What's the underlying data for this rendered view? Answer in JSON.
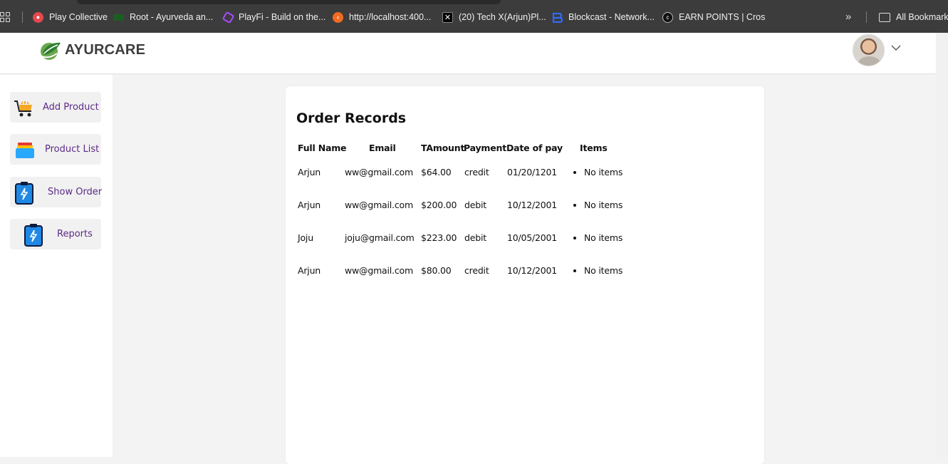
{
  "bookmarks": {
    "items": [
      {
        "label": "Play Collective",
        "icon": "play-collective-icon",
        "color": "#e5484d"
      },
      {
        "label": "Root - Ayurveda an...",
        "icon": "root-icon",
        "color": "#2e7d32"
      },
      {
        "label": "PlayFi - Build on the...",
        "icon": "playfi-icon",
        "color": "#a64dff"
      },
      {
        "label": "http://localhost:400...",
        "icon": "localhost-icon",
        "color": "#f26b22"
      },
      {
        "label": "(20) Tech X(Arjun)Pl...",
        "icon": "x-icon",
        "color": "#000000"
      },
      {
        "label": "Blockcast - Network...",
        "icon": "blockcast-icon",
        "color": "#2563eb"
      },
      {
        "label": "EARN POINTS | Cros",
        "icon": "earn-points-icon",
        "color": "#111111"
      }
    ],
    "more": "»",
    "all_bookmarks": "All Bookmarks"
  },
  "header": {
    "logo_text": "AYURCARE"
  },
  "sidebar": {
    "items": [
      {
        "label": "Add Product",
        "icon": "cart-icon"
      },
      {
        "label": "Product List",
        "icon": "stack-icon"
      },
      {
        "label": "Show Order",
        "icon": "clipboard-icon"
      },
      {
        "label": "Reports",
        "icon": "clipboard-icon"
      }
    ]
  },
  "orders": {
    "title": "Order Records",
    "columns": [
      "Full Name",
      "Email",
      "TAmount",
      "Payment",
      "Date of pay",
      "Items"
    ],
    "rows": [
      {
        "name": "Arjun",
        "email": "ww@gmail.com",
        "amount": "$64.00",
        "payment": "credit",
        "date": "01/20/1201",
        "items": "No items"
      },
      {
        "name": "Arjun",
        "email": "ww@gmail.com",
        "amount": "$200.00",
        "payment": "debit",
        "date": "10/12/2001",
        "items": "No items"
      },
      {
        "name": "Joju",
        "email": "joju@gmail.com",
        "amount": "$223.00",
        "payment": "debit",
        "date": "10/05/2001",
        "items": "No items"
      },
      {
        "name": "Arjun",
        "email": "ww@gmail.com",
        "amount": "$80.00",
        "payment": "credit",
        "date": "10/12/2001",
        "items": "No items"
      }
    ]
  },
  "colors": {
    "nav_text": "#5b2a86",
    "bookmarks_bg": "#3c3c3c",
    "page_bg": "#f3f3f3"
  }
}
